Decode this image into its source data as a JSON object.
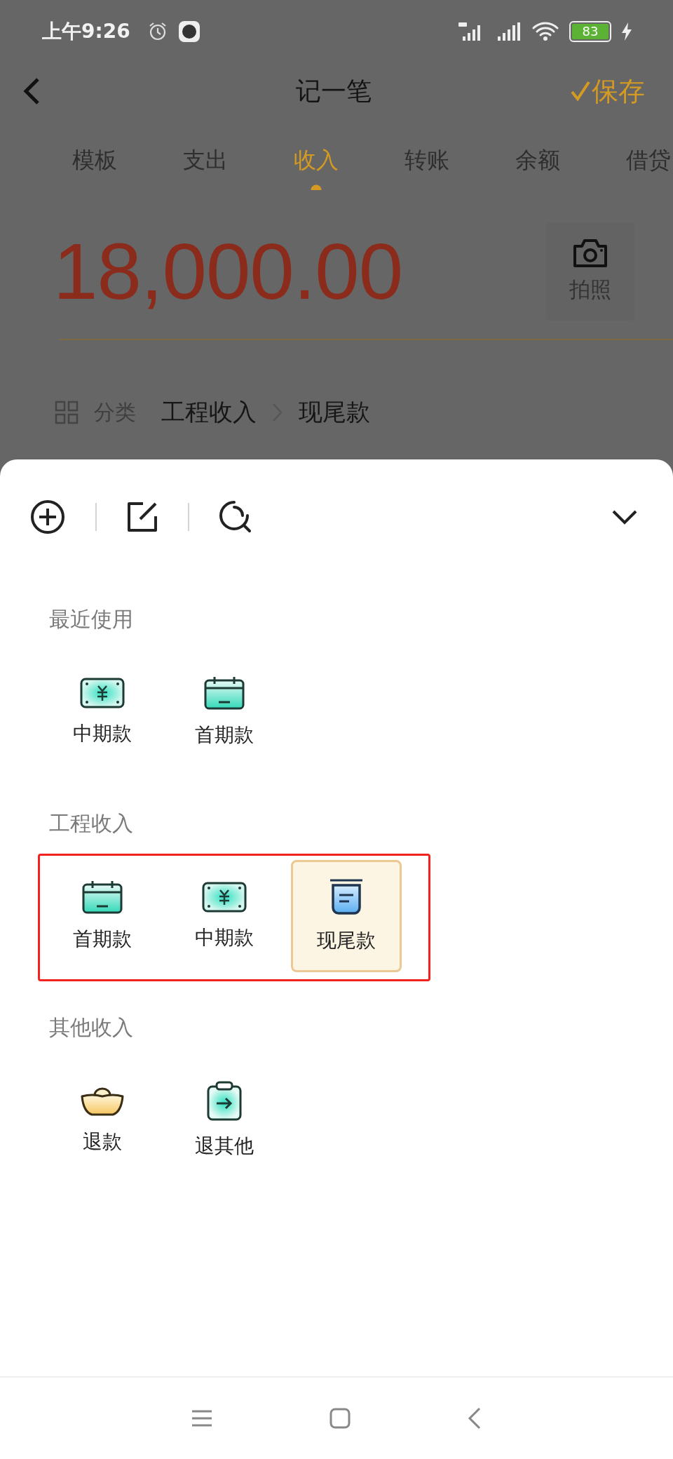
{
  "status_bar": {
    "time": "上午9:26",
    "battery": "83"
  },
  "header": {
    "title": "记一笔",
    "save": "保存"
  },
  "tabs": [
    {
      "label": "模板",
      "selected": false
    },
    {
      "label": "支出",
      "selected": false
    },
    {
      "label": "收入",
      "selected": true
    },
    {
      "label": "转账",
      "selected": false
    },
    {
      "label": "余额",
      "selected": false
    },
    {
      "label": "借贷",
      "selected": false
    }
  ],
  "amount": "18,000.00",
  "photo_button": "拍照",
  "category_row": {
    "label": "分类",
    "parent": "工程收入",
    "child": "现尾款"
  },
  "sheet": {
    "sections": [
      {
        "title": "最近使用",
        "highlighted": false,
        "items": [
          {
            "label": "中期款",
            "kind": "banknote",
            "selected": false
          },
          {
            "label": "首期款",
            "kind": "calendar",
            "selected": false
          }
        ]
      },
      {
        "title": "工程收入",
        "highlighted": true,
        "items": [
          {
            "label": "首期款",
            "kind": "calendar",
            "selected": false
          },
          {
            "label": "中期款",
            "kind": "banknote",
            "selected": false
          },
          {
            "label": "现尾款",
            "kind": "jar",
            "selected": true
          }
        ]
      },
      {
        "title": "其他收入",
        "highlighted": false,
        "items": [
          {
            "label": "退款",
            "kind": "ingot",
            "selected": false
          },
          {
            "label": "退其他",
            "kind": "clipboard",
            "selected": false
          }
        ]
      }
    ]
  }
}
